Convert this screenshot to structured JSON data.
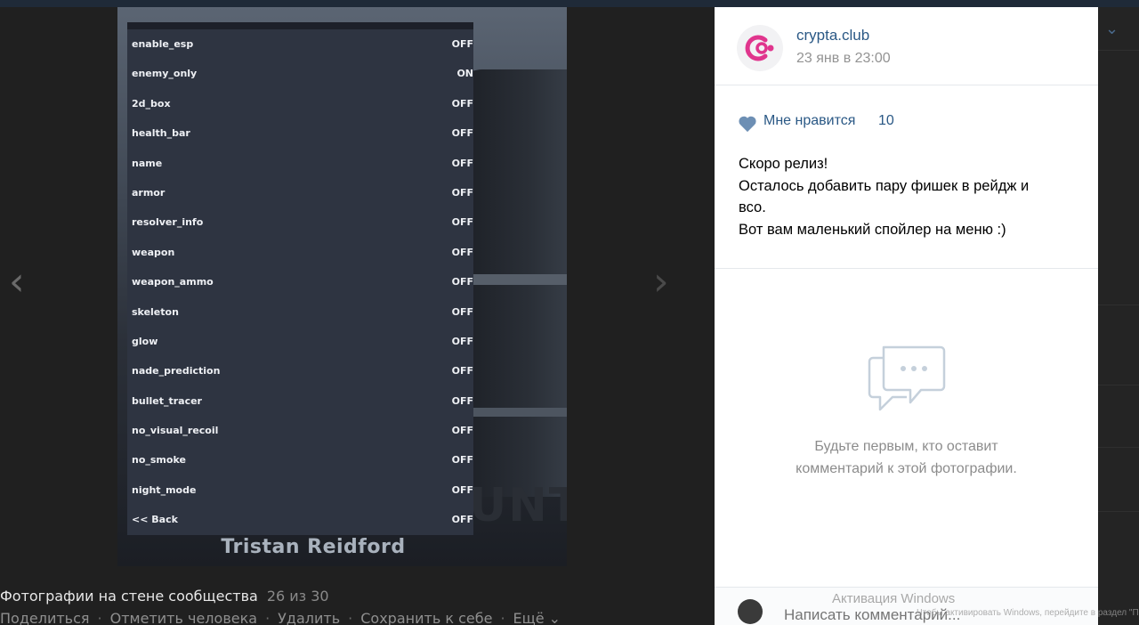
{
  "esp_menu": {
    "items": [
      {
        "label": "enable_esp",
        "value": "OFF"
      },
      {
        "label": "enemy_only",
        "value": "ON"
      },
      {
        "label": "2d_box",
        "value": "OFF"
      },
      {
        "label": "health_bar",
        "value": "OFF"
      },
      {
        "label": "name",
        "value": "OFF"
      },
      {
        "label": "armor",
        "value": "OFF"
      },
      {
        "label": "resolver_info",
        "value": "OFF"
      },
      {
        "label": "weapon",
        "value": "OFF"
      },
      {
        "label": "weapon_ammo",
        "value": "OFF"
      },
      {
        "label": "skeleton",
        "value": "OFF"
      },
      {
        "label": "glow",
        "value": "OFF"
      },
      {
        "label": "nade_prediction",
        "value": "OFF"
      },
      {
        "label": "bullet_tracer",
        "value": "OFF"
      },
      {
        "label": "no_visual_recoil",
        "value": "OFF"
      },
      {
        "label": "no_smoke",
        "value": "OFF"
      },
      {
        "label": "night_mode",
        "value": "OFF"
      },
      {
        "label": "<< Back",
        "value": "OFF"
      }
    ]
  },
  "photo": {
    "character_name": "Tristan Reidford",
    "bg_letters": "UNT"
  },
  "caption": {
    "album": "Фотографии на стене сообщества",
    "position": "26 из 30"
  },
  "actions": {
    "share": "Поделиться",
    "tag": "Отметить человека",
    "delete": "Удалить",
    "save": "Сохранить к себе",
    "more": "Ещё"
  },
  "post": {
    "group_name": "crypta.club",
    "date": "23 янв в 23:00",
    "like_label": "Мне нравится",
    "like_count": "10",
    "text_lines": [
      "Скоро релиз!",
      "Осталось добавить пару фишек в рейдж и",
      "всо.",
      "Вот вам маленький спойлер на меню :)"
    ]
  },
  "comments": {
    "empty_line1": "Будьте первым, кто оставит",
    "empty_line2": "комментарий к этой фотографии.",
    "input_placeholder": "Написать комментарий..."
  },
  "watermark": {
    "line1": "Активация Windows",
    "line2": "Чтобы активировать Windows, перейдите в раздел \"Параметры\""
  },
  "colors": {
    "link": "#2a5885",
    "menu_bg": "#2e3441",
    "logo_accent": "#e0358d"
  }
}
